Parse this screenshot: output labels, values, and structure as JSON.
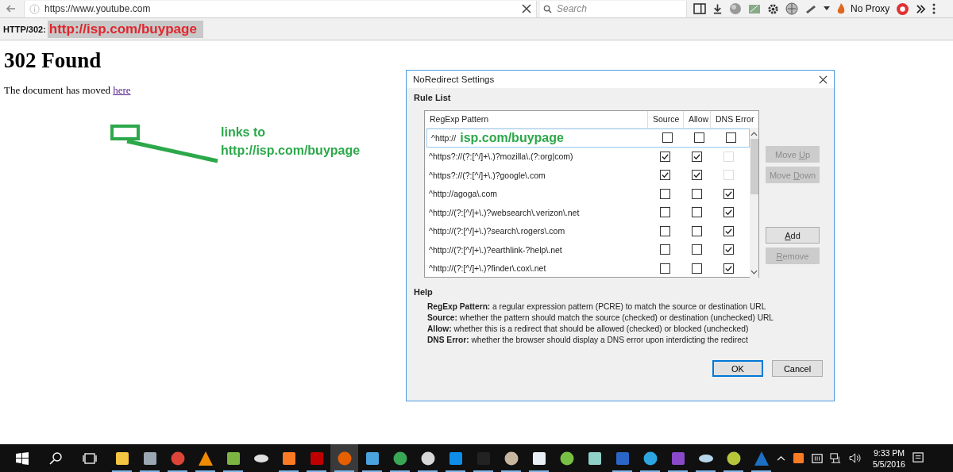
{
  "browser": {
    "url": "https://www.youtube.com",
    "search": {
      "placeholder": "Search"
    },
    "proxy_label": "No Proxy"
  },
  "status_bar": {
    "code": "HTTP/302:",
    "location": "http://isp.com/buypage"
  },
  "page": {
    "heading": "302 Found",
    "text": "The document has moved",
    "link": "here"
  },
  "annotation": {
    "lines": [
      "links to",
      "http://isp.com/buypage"
    ]
  },
  "dialog": {
    "title": "NoRedirect Settings",
    "section": "Rule List",
    "columns": [
      "RegExp Pattern",
      "Source",
      "Allow",
      "DNS Error"
    ],
    "rows": [
      {
        "pattern": "^http://",
        "overlay": "isp.com/buypage",
        "selected": true,
        "source": false,
        "allow": false,
        "dns": false,
        "dns_disabled": false
      },
      {
        "pattern": "^https?://(?:[^/]+\\.)?mozilla\\.(?:org|com)",
        "selected": false,
        "source": true,
        "allow": true,
        "dns": false,
        "dns_disabled": true
      },
      {
        "pattern": "^https?://(?:[^/]+\\.)?google\\.com",
        "selected": false,
        "source": true,
        "allow": true,
        "dns": false,
        "dns_disabled": true
      },
      {
        "pattern": "^http://agoga\\.com",
        "selected": false,
        "source": false,
        "allow": false,
        "dns": true,
        "dns_disabled": false
      },
      {
        "pattern": "^http://(?:[^/]+\\.)?websearch\\.verizon\\.net",
        "selected": false,
        "source": false,
        "allow": false,
        "dns": true,
        "dns_disabled": false
      },
      {
        "pattern": "^http://(?:[^/]+\\.)?search\\.rogers\\.com",
        "selected": false,
        "source": false,
        "allow": false,
        "dns": true,
        "dns_disabled": false
      },
      {
        "pattern": "^http://(?:[^/]+\\.)?earthlink-?help\\.net",
        "selected": false,
        "source": false,
        "allow": false,
        "dns": true,
        "dns_disabled": false
      },
      {
        "pattern": "^http://(?:[^/]+\\.)?finder\\.cox\\.net",
        "selected": false,
        "source": false,
        "allow": false,
        "dns": true,
        "dns_disabled": false
      }
    ],
    "side_buttons": [
      {
        "label_before": "Move ",
        "access_key": "U",
        "label_after": "p",
        "disabled": true
      },
      {
        "label_before": "Move ",
        "access_key": "D",
        "label_after": "own",
        "disabled": true
      },
      {
        "access_key": "A",
        "label_after": "dd",
        "disabled": false
      },
      {
        "access_key": "R",
        "label_after": "emove",
        "disabled": true
      }
    ],
    "help_title": "Help",
    "help": [
      "**RegExp Pattern:** a regular expression pattern (PCRE) to match the source or destination URL",
      "**Source:** whether the pattern should match the source (checked) or destination (unchecked) URL",
      "**Allow:** whether this is a redirect that should be allowed (checked) or blocked (unchecked)",
      "**DNS Error:** whether the browser should display a DNS error upon interdicting the redirect"
    ],
    "buttons": [
      {
        "label": "OK",
        "selected": true
      },
      {
        "label": "Cancel",
        "selected": false
      }
    ]
  },
  "taskbar": {
    "apps": [
      {
        "running": true,
        "selected": false
      },
      {
        "running": true,
        "selected": false
      },
      {
        "running": true,
        "selected": false
      },
      {
        "running": true,
        "selected": false
      },
      {
        "running": true,
        "selected": false
      },
      {
        "running": false,
        "selected": false
      },
      {
        "running": true,
        "selected": false
      },
      {
        "running": true,
        "selected": false
      },
      {
        "running": true,
        "selected": true
      },
      {
        "running": true,
        "selected": false
      },
      {
        "running": true,
        "selected": false
      },
      {
        "running": true,
        "selected": false
      },
      {
        "running": true,
        "selected": false
      },
      {
        "running": true,
        "selected": false
      },
      {
        "running": true,
        "selected": false
      },
      {
        "running": true,
        "selected": false
      },
      {
        "running": false,
        "selected": false
      },
      {
        "running": false,
        "selected": false
      },
      {
        "running": true,
        "selected": false
      },
      {
        "running": true,
        "selected": false
      },
      {
        "running": true,
        "selected": false
      },
      {
        "running": true,
        "selected": false
      },
      {
        "running": true,
        "selected": false
      },
      {
        "running": true,
        "selected": false
      }
    ],
    "time": "9:33 PM",
    "date": "5/5/2016"
  }
}
